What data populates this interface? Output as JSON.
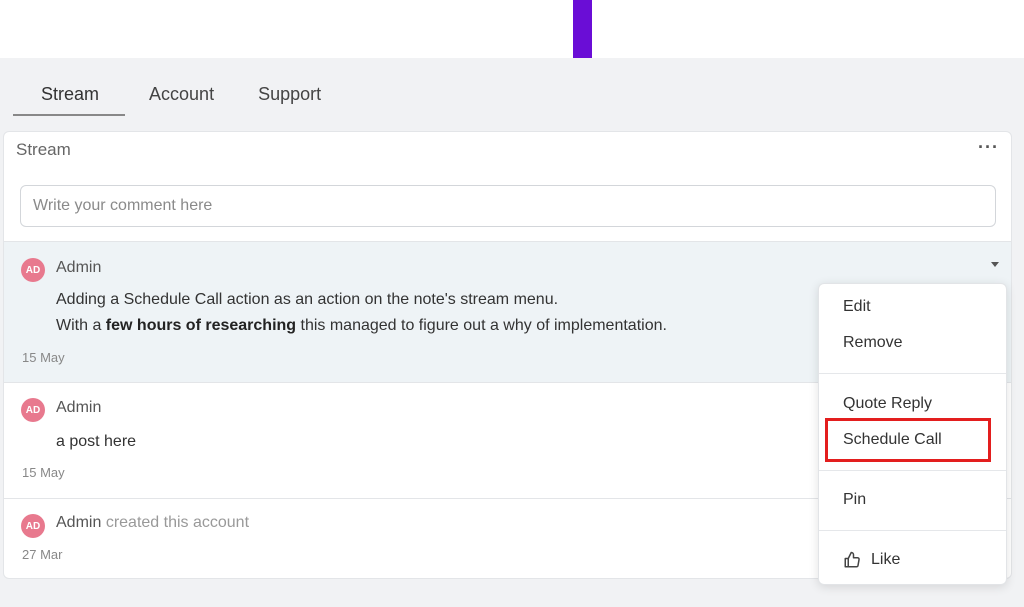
{
  "tabs": [
    {
      "label": "Stream",
      "active": true
    },
    {
      "label": "Account",
      "active": false
    },
    {
      "label": "Support",
      "active": false
    }
  ],
  "panel": {
    "title": "Stream",
    "more_icon": "ellipsis-icon",
    "comment_placeholder": "Write your comment here"
  },
  "entries": [
    {
      "avatar": "AD",
      "author": "Admin",
      "line1": "Adding a Schedule Call action as an action on the note's stream menu.",
      "line2_prefix": "With a ",
      "line2_bold": "few hours of researching",
      "line2_suffix": " this managed to figure out a why of implementation.",
      "date": "15 May"
    },
    {
      "avatar": "AD",
      "author": "Admin",
      "line1": "a post here",
      "date": "15 May"
    },
    {
      "avatar": "AD",
      "author": "Admin",
      "action": "created this account",
      "date": "27 Mar"
    }
  ],
  "menu": {
    "edit": "Edit",
    "remove": "Remove",
    "quote_reply": "Quote Reply",
    "schedule_call": "Schedule Call",
    "pin": "Pin",
    "like": "Like"
  },
  "colors": {
    "accent": "#6a0dd6",
    "avatar": "#e8798e",
    "highlight": "#e31e1e"
  }
}
